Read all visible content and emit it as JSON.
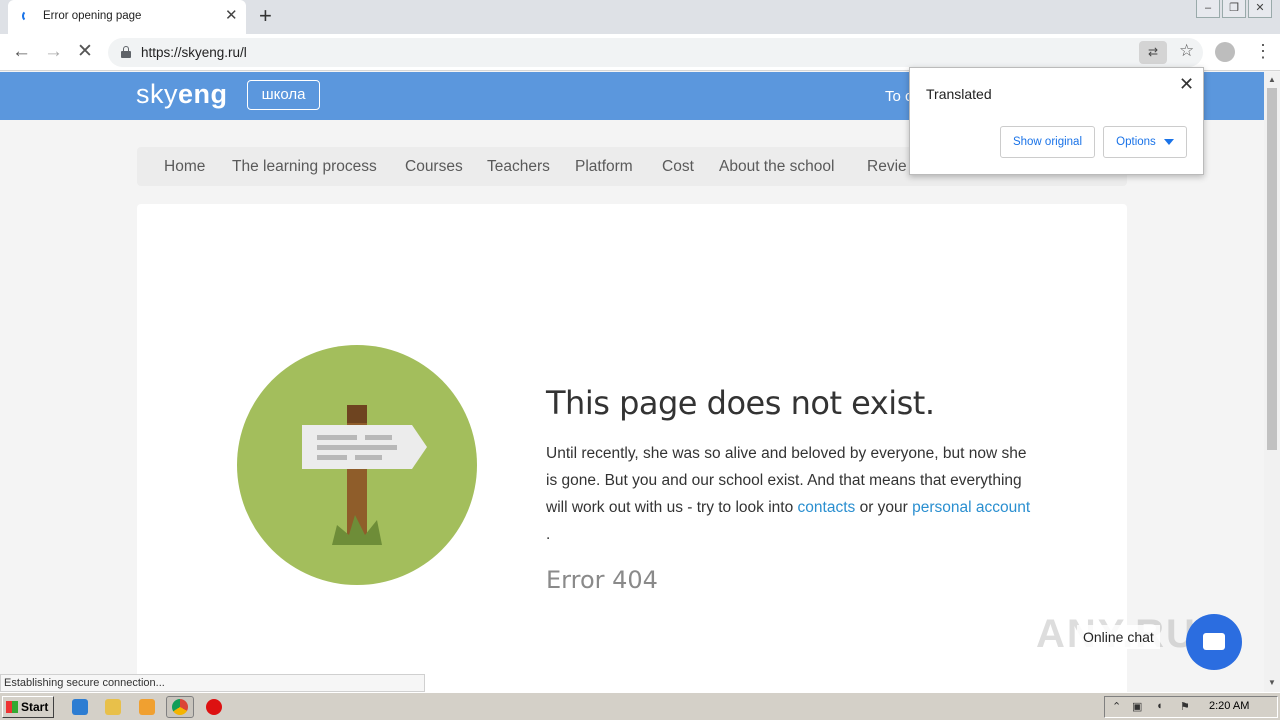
{
  "browser": {
    "tab_title": "Error opening page",
    "url": "https://skyeng.ru/l",
    "icons": [
      "back-arrow-icon",
      "forward-arrow-icon",
      "stop-icon",
      "lock-icon",
      "translate-icon",
      "star-icon",
      "profile-icon",
      "menu-kebab-icon"
    ]
  },
  "site": {
    "logo_light": "sky",
    "logo_bold": "eng",
    "school_badge": "школа",
    "header_cta": "To c",
    "nav": [
      "Home",
      "The learning process",
      "Courses",
      "Teachers",
      "Platform",
      "Cost",
      "About the school",
      "Revie"
    ],
    "colors": {
      "header": "#5b97dd",
      "illustration": "#a3be5c",
      "link": "#2a8fd0"
    }
  },
  "error": {
    "title": "This page does not exist.",
    "text_1": "Until recently, she was so alive and beloved by everyone, but now she is gone. But you and our school exist. And that means that everything will work out with us - try to look into ",
    "link_contacts": "contacts",
    "text_2": " or your ",
    "link_account": "personal account",
    "text_3": " .",
    "code": "Error 404"
  },
  "translate_popup": {
    "title": "Translated",
    "show_original": "Show original",
    "options": "Options"
  },
  "status_bar": "Establishing secure connection...",
  "chat": {
    "label": "Online chat"
  },
  "taskbar": {
    "start": "Start",
    "time": "2:20 AM"
  },
  "watermark": "ANY.RUN"
}
